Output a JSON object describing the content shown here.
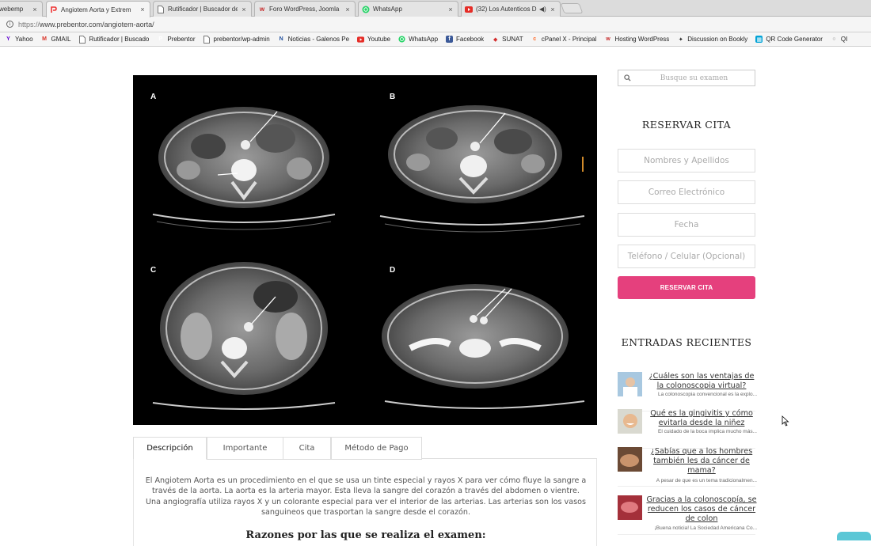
{
  "browser": {
    "tabs": [
      {
        "label": "webemp",
        "icon": "page-icon",
        "active": false
      },
      {
        "label": "Angiotem Aorta y Extrem",
        "icon": "prebentor-icon",
        "active": true
      },
      {
        "label": "Rutificador | Buscador de",
        "icon": "page-icon",
        "active": false
      },
      {
        "label": "Foro WordPress, Joomla",
        "icon": "forum-icon",
        "active": false
      },
      {
        "label": "WhatsApp",
        "icon": "whatsapp-icon",
        "active": false
      },
      {
        "label": "(32) Los Autenticos D",
        "icon": "youtube-icon",
        "active": false
      }
    ],
    "close_glyph": "×",
    "url_protocol": "https://",
    "url_rest": "www.prebentor.com/angiotem-aorta/",
    "bookmarks": [
      {
        "label": "Yahoo",
        "icon": "yahoo-icon",
        "color": "#5f01d1"
      },
      {
        "label": "GMAIL",
        "icon": "gmail-icon",
        "color": "#d93025"
      },
      {
        "label": "Rutificador | Buscado",
        "icon": "page-icon",
        "color": "#ffffff"
      },
      {
        "label": "Prebentor",
        "icon": "prebentor-icon",
        "color": "#ffffff"
      },
      {
        "label": "prebentor/wp-admin",
        "icon": "page-icon",
        "color": "#ffffff"
      },
      {
        "label": "Noticias - Galenos Pe",
        "icon": "news-icon",
        "color": "#1f4e9c"
      },
      {
        "label": "Youtube",
        "icon": "youtube-icon",
        "color": "#e52d27"
      },
      {
        "label": "WhatsApp",
        "icon": "whatsapp-icon",
        "color": "#25d366"
      },
      {
        "label": "Facebook",
        "icon": "facebook-icon",
        "color": "#3b5998"
      },
      {
        "label": "SUNAT",
        "icon": "sunat-icon",
        "color": "#d32f2f"
      },
      {
        "label": "cPanel X - Principal",
        "icon": "cpanel-icon",
        "color": "#ff6c2c"
      },
      {
        "label": "Hosting WordPress",
        "icon": "hosting-icon",
        "color": "#c62828"
      },
      {
        "label": "Discussion on Bookly",
        "icon": "bookly-icon",
        "color": "#222222"
      },
      {
        "label": "QR Code Generator",
        "icon": "qr-icon",
        "color": "#00a2d6"
      },
      {
        "label": "QI",
        "icon": "globe-icon",
        "color": "#777777"
      }
    ]
  },
  "hero": {
    "labels": [
      "A",
      "B",
      "C",
      "D"
    ]
  },
  "content_tabs": [
    {
      "label": "Descripción",
      "active": true
    },
    {
      "label": "Importante",
      "active": false
    },
    {
      "label": "Cita",
      "active": false
    },
    {
      "label": "Método de Pago",
      "active": false
    }
  ],
  "description": "El Angiotem Aorta es un procedimiento en el que se usa un tinte especial y rayos X para ver cómo fluye la sangre a través de la aorta. La aorta es la arteria mayor. Esta lleva la sangre del corazón a través del abdomen o vientre. Una angiografía utiliza rayos X y un colorante especial para ver el interior de las arterias. Las arterias son los vasos sanguineos que trasportan la sangre desde el corazón.",
  "razones_heading": "Razones por las que se realiza el examen:",
  "sidebar": {
    "search_placeholder": "Busque su examen",
    "reserve_title": "RESERVAR CITA",
    "fields": {
      "name": "Nombres y Apellidos",
      "email": "Correo Electrónico",
      "date": "Fecha",
      "phone": "Teléfono / Celular (Opcional)"
    },
    "reserve_button": "RESERVAR CITA",
    "recent_title": "ENTRADAS RECIENTES",
    "recent_posts": [
      {
        "title": "¿Cuáles son las ventajas de la colonoscopia virtual?",
        "excerpt": "La colonoscopia convencional es la explo..."
      },
      {
        "title": "Qué es la gingivitis y cómo evitarla desde la niñez",
        "excerpt": "El cuidado de la boca implica mucho más..."
      },
      {
        "title": "¿Sabías que a los hombres también les da cáncer de mama?",
        "excerpt": "A pesar de que es un tema tradicionalmen..."
      },
      {
        "title": "Gracias a la colonoscopía, se reducen los casos de cáncer de colon",
        "excerpt": "¡Buena noticia! La Sociedad Americana Co..."
      }
    ]
  }
}
